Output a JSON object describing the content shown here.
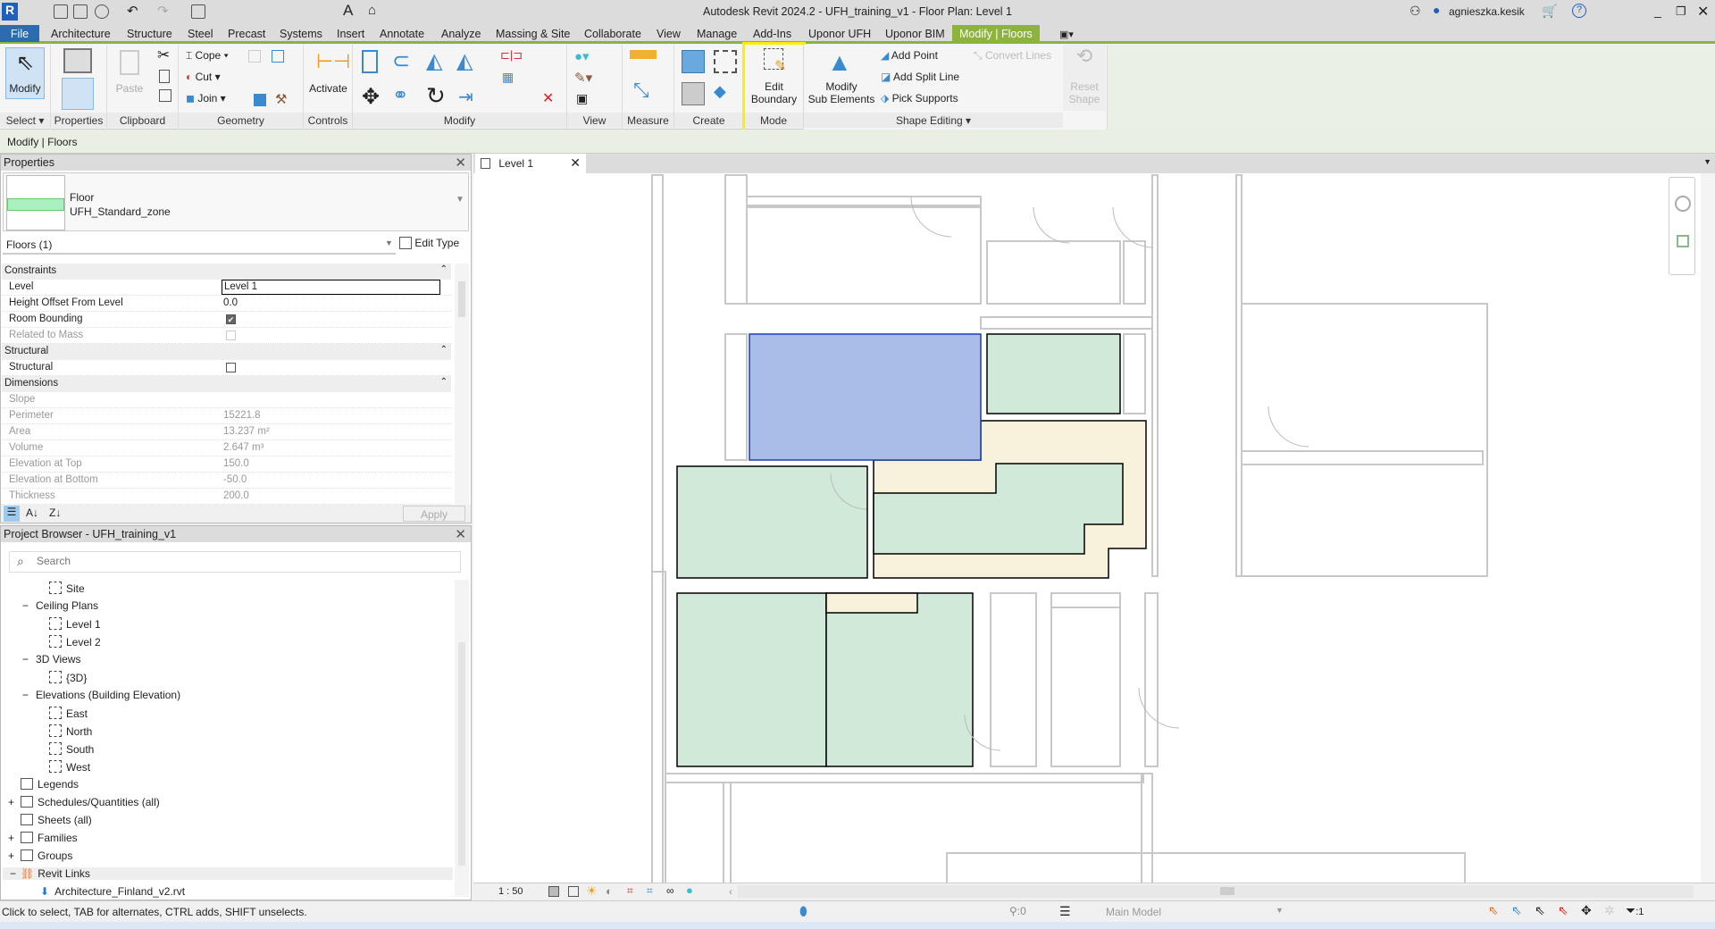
{
  "app": {
    "title": "Autodesk Revit 2024.2 - UFH_training_v1 - Floor Plan: Level 1",
    "user": "agnieszka.kesik"
  },
  "tabs": [
    "File",
    "Architecture",
    "Structure",
    "Steel",
    "Precast",
    "Systems",
    "Insert",
    "Annotate",
    "Analyze",
    "Massing & Site",
    "Collaborate",
    "View",
    "Manage",
    "Add-Ins",
    "Uponor UFH",
    "Uponor BIM",
    "Modify | Floors"
  ],
  "ribbon": {
    "select": {
      "modify": "Modify",
      "label": "Select ▾"
    },
    "properties": {
      "label": "Properties"
    },
    "clipboard": {
      "paste": "Paste",
      "label": "Clipboard"
    },
    "geometry": {
      "cope": "Cope",
      "cut": "Cut",
      "join": "Join",
      "label": "Geometry"
    },
    "controls": {
      "activate": "Activate",
      "label": "Controls"
    },
    "modify": {
      "label": "Modify"
    },
    "view": {
      "label": "View"
    },
    "measure": {
      "label": "Measure"
    },
    "create": {
      "label": "Create"
    },
    "mode": {
      "edit_boundary_1": "Edit",
      "edit_boundary_2": "Boundary",
      "label": "Mode"
    },
    "shape_editing": {
      "modify_sub_1": "Modify",
      "modify_sub_2": "Sub Elements",
      "add_point": "Add Point",
      "add_split_line": "Add Split Line",
      "pick_supports": "Pick Supports",
      "convert_lines": "Convert Lines",
      "reset_1": "Reset",
      "reset_2": "Shape",
      "label": "Shape Editing ▾"
    }
  },
  "options_bar": {
    "context": "Modify | Floors"
  },
  "properties": {
    "title": "Properties",
    "family": "Floor",
    "type": "UFH_Standard_zone",
    "swatch_color": "#a8f0c0",
    "filter": "Floors (1)",
    "edit_type": "Edit Type",
    "apply": "Apply",
    "groups": {
      "constraints": "Constraints",
      "structural": "Structural",
      "dimensions": "Dimensions"
    },
    "rows": {
      "level": {
        "label": "Level",
        "value": "Level 1"
      },
      "height_offset": {
        "label": "Height Offset From Level",
        "value": "0.0"
      },
      "room_bounding": {
        "label": "Room Bounding",
        "checked": true
      },
      "related_to_mass": {
        "label": "Related to Mass",
        "checked": false
      },
      "structural": {
        "label": "Structural",
        "checked": false
      },
      "slope": {
        "label": "Slope",
        "value": ""
      },
      "perimeter": {
        "label": "Perimeter",
        "value": "15221.8"
      },
      "area": {
        "label": "Area",
        "value": "13.237 m²"
      },
      "volume": {
        "label": "Volume",
        "value": "2.647 m³"
      },
      "elev_top": {
        "label": "Elevation at Top",
        "value": "150.0"
      },
      "elev_bottom": {
        "label": "Elevation at Bottom",
        "value": "-50.0"
      },
      "thickness": {
        "label": "Thickness",
        "value": "200.0"
      }
    }
  },
  "browser": {
    "title": "Project Browser - UFH_training_v1",
    "search_placeholder": "Search",
    "items": [
      {
        "label": "Site",
        "indent": 2,
        "icon": "view"
      },
      {
        "label": "Ceiling Plans",
        "indent": 1,
        "icon": "minus"
      },
      {
        "label": "Level 1",
        "indent": 2,
        "icon": "view"
      },
      {
        "label": "Level 2",
        "indent": 2,
        "icon": "view"
      },
      {
        "label": "3D Views",
        "indent": 1,
        "icon": "minus"
      },
      {
        "label": "{3D}",
        "indent": 2,
        "icon": "view"
      },
      {
        "label": "Elevations (Building Elevation)",
        "indent": 1,
        "icon": "minus"
      },
      {
        "label": "East",
        "indent": 2,
        "icon": "view"
      },
      {
        "label": "North",
        "indent": 2,
        "icon": "view"
      },
      {
        "label": "South",
        "indent": 2,
        "icon": "view"
      },
      {
        "label": "West",
        "indent": 2,
        "icon": "view"
      },
      {
        "label": "Legends",
        "indent": 0,
        "icon": "legend"
      },
      {
        "label": "Schedules/Quantities (all)",
        "indent": 0,
        "icon": "schedule",
        "expand": "+"
      },
      {
        "label": "Sheets (all)",
        "indent": 0,
        "icon": "sheet"
      },
      {
        "label": "Families",
        "indent": 0,
        "icon": "family",
        "expand": "+"
      },
      {
        "label": "Groups",
        "indent": 0,
        "icon": "group",
        "expand": "+"
      },
      {
        "label": "Revit Links",
        "indent": 0,
        "icon": "link",
        "expand": "−",
        "highlight": true
      },
      {
        "label": "Architecture_Finland_v2.rvt",
        "indent": 1,
        "icon": "arrow"
      }
    ]
  },
  "view": {
    "tab": "Level 1",
    "scale": "1 : 50"
  },
  "status": {
    "hint": "Click to select, TAB for alternates, CTRL adds, SHIFT unselects.",
    "selection_count": ":0",
    "model": "Main Model",
    "filter_count": ":1"
  },
  "colors": {
    "accent": "#8cb43c",
    "file_tab": "#2b6cb0",
    "selected_floor": "#aabde8",
    "floor_green": "#d0e9d8",
    "floor_yellow": "#f8f2dc",
    "highlight_box": "#ffee00"
  }
}
